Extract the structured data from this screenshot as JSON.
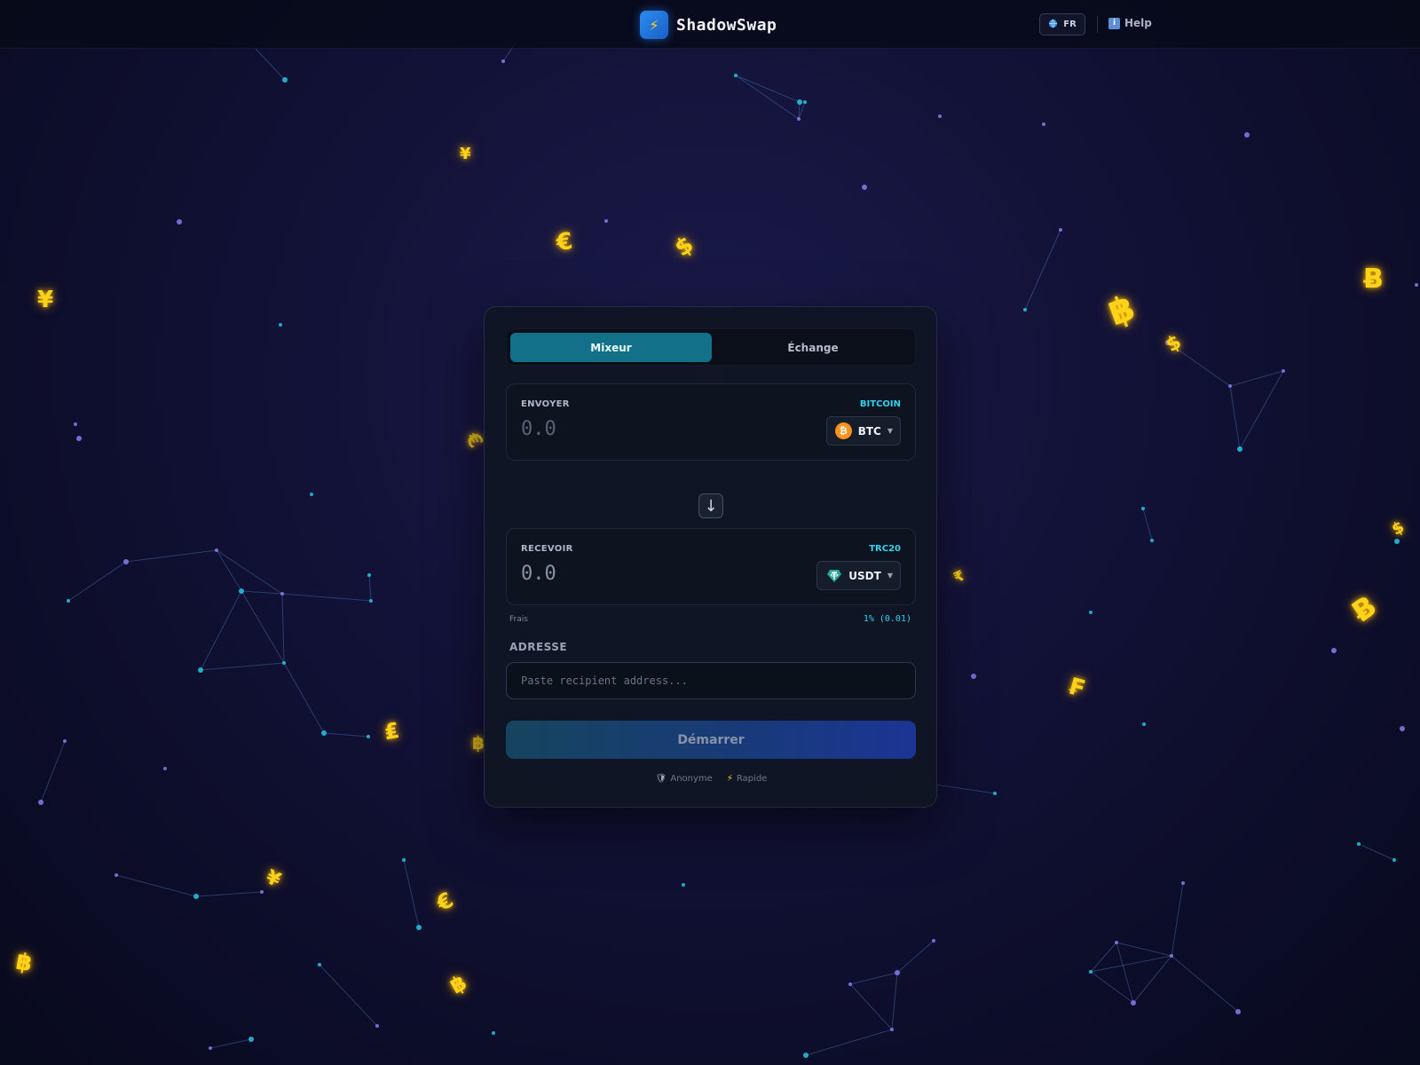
{
  "header": {
    "brand_name": "ShadowSwap",
    "brand_icon": "lightning-icon",
    "language": "FR",
    "help_label": "Help"
  },
  "tabs": [
    {
      "label": "Mixeur",
      "active": true
    },
    {
      "label": "Échange",
      "active": false
    }
  ],
  "send": {
    "label": "ENVOYER",
    "network": "BITCOIN",
    "amount_placeholder": "0.0",
    "coin": "BTC"
  },
  "receive": {
    "label": "RECEVOIR",
    "network": "TRC20",
    "amount": "0.0",
    "coin": "USDT"
  },
  "fee": {
    "label": "Frais",
    "value": "1% (0.01)"
  },
  "address": {
    "label": "ADRESSE",
    "placeholder": "Paste recipient address..."
  },
  "start_label": "Démarrer",
  "features": [
    {
      "icon": "shield-icon",
      "label": "Anonyme"
    },
    {
      "icon": "lightning-icon",
      "label": "Rapide"
    }
  ],
  "colors": {
    "accent": "#137089",
    "network_text": "#2ed3f0",
    "btc": "#f7931a",
    "usdt": "#26a69a",
    "glyph": "#ffd21a"
  }
}
